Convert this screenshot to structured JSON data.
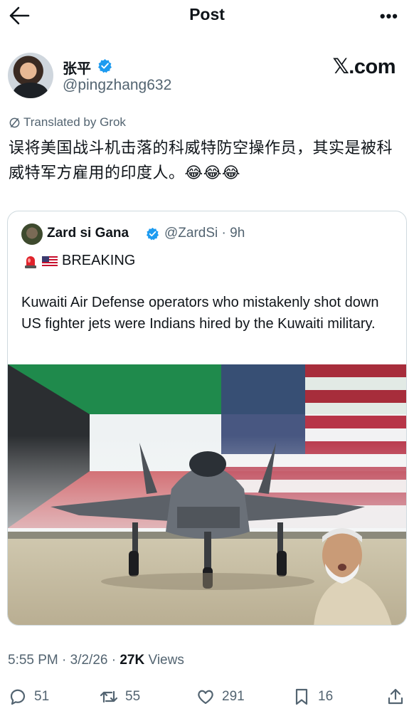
{
  "header": {
    "title": "Post",
    "more": "•••"
  },
  "author": {
    "name": "张平",
    "handle": "@pingzhang632",
    "watermark": "𝕏.com"
  },
  "post": {
    "translated_label": "Translated by Grok",
    "text": "误将美国战斗机击落的科威特防空操作员，其实是被科威特军方雇用的印度人。😂😂😂"
  },
  "quote": {
    "name": "Zard si Gana",
    "handle_time": "@ZardSi · 9h",
    "breaking": "BREAKING",
    "text": "Kuwaiti Air Defense operators who mistakenly shot down US fighter jets were Indians hired by the Kuwaiti military."
  },
  "meta": {
    "time_date": "5:55 PM · 3/2/26 · ",
    "views_count": "27K",
    "views_label": " Views"
  },
  "actions": {
    "replies": "51",
    "reposts": "55",
    "likes": "291",
    "bookmarks": "16"
  },
  "colors": {
    "verified": "#1d9bf0",
    "secondary_text": "#536471",
    "border": "#cfd9de"
  },
  "icons": [
    "back-arrow-icon",
    "more-icon",
    "verified-icon",
    "translate-icon",
    "siren-icon",
    "us-flag-icon",
    "reply-icon",
    "repost-icon",
    "like-icon",
    "bookmark-icon",
    "share-icon"
  ]
}
